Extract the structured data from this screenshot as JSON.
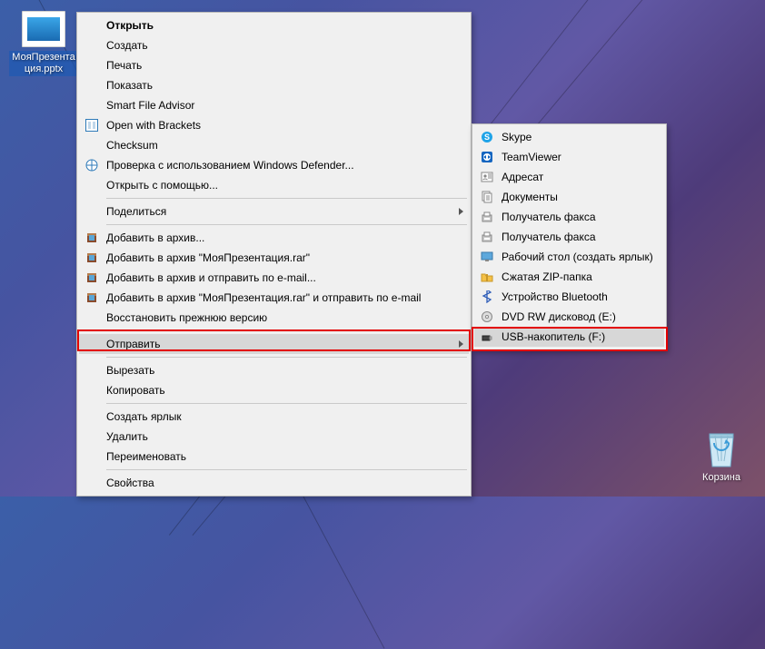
{
  "desktop": {
    "file_name": "МояПрезентация.pptx",
    "recycle_bin": "Корзина"
  },
  "main_menu": {
    "open": "Открыть",
    "create": "Создать",
    "print": "Печать",
    "show": "Показать",
    "smart_file_advisor": "Smart File Advisor",
    "open_with_brackets": "Open with Brackets",
    "checksum": "Checksum",
    "defender_check": "Проверка с использованием Windows Defender...",
    "open_with": "Открыть с помощью...",
    "share": "Поделиться",
    "add_to_archive": "Добавить в архив...",
    "add_to_rar": "Добавить в архив \"МояПрезентация.rar\"",
    "add_and_email": "Добавить в архив и отправить по e-mail...",
    "add_rar_and_email": "Добавить в архив \"МояПрезентация.rar\" и отправить по e-mail",
    "restore_prev": "Восстановить прежнюю версию",
    "send_to": "Отправить",
    "cut": "Вырезать",
    "copy": "Копировать",
    "create_shortcut": "Создать ярлык",
    "delete": "Удалить",
    "rename": "Переименовать",
    "properties": "Свойства"
  },
  "submenu": {
    "skype": "Skype",
    "teamviewer": "TeamViewer",
    "contact": "Адресат",
    "documents": "Документы",
    "fax_recipient1": "Получатель факса",
    "fax_recipient2": "Получатель факса",
    "desktop_shortcut": "Рабочий стол (создать ярлык)",
    "zip_folder": "Сжатая ZIP-папка",
    "bluetooth": "Устройство Bluetooth",
    "dvd_rw": "DVD RW дисковод (E:)",
    "usb_drive": "USB-накопитель (F:)"
  }
}
